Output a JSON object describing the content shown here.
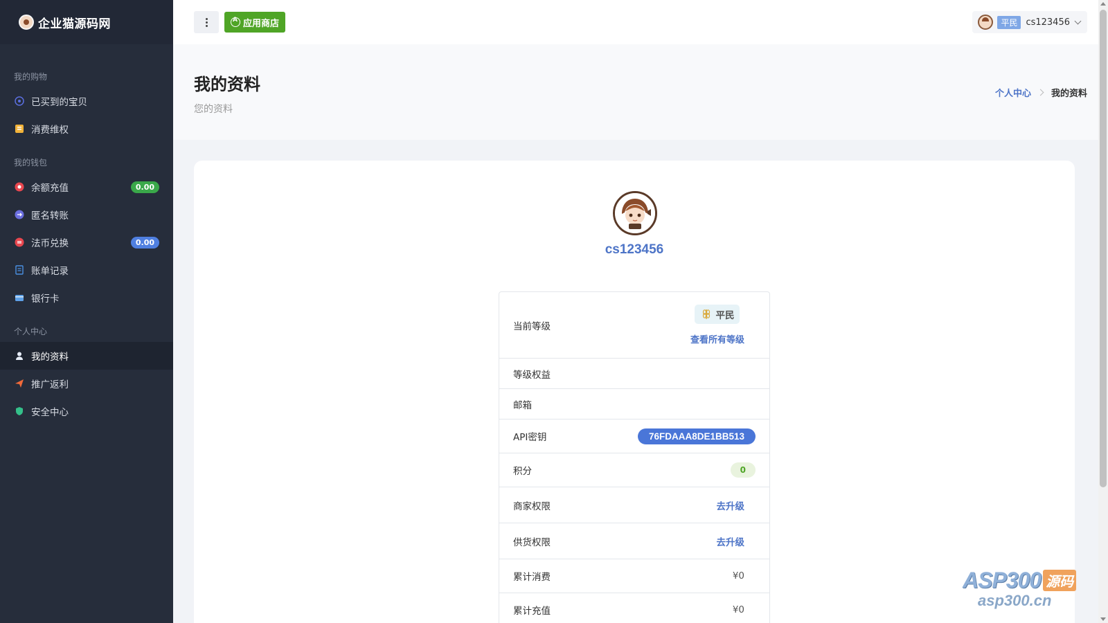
{
  "brand": {
    "name": "企业猫源码网"
  },
  "sidebar": {
    "sections": [
      {
        "title": "我的购物",
        "items": [
          {
            "label": "已买到的宝贝",
            "icon": "bag-circle-icon"
          },
          {
            "label": "消费维权",
            "icon": "complaint-icon"
          }
        ]
      },
      {
        "title": "我的钱包",
        "items": [
          {
            "label": "余额充值",
            "icon": "recharge-icon",
            "badge": "0.00"
          },
          {
            "label": "匿名转账",
            "icon": "transfer-icon"
          },
          {
            "label": "法币兑换",
            "icon": "exchange-icon",
            "badge": "0.00"
          },
          {
            "label": "账单记录",
            "icon": "bill-icon"
          },
          {
            "label": "银行卡",
            "icon": "bank-card-icon"
          }
        ]
      },
      {
        "title": "个人中心",
        "items": [
          {
            "label": "我的资料",
            "icon": "user-icon",
            "active": true
          },
          {
            "label": "推广返利",
            "icon": "paper-plane-icon"
          },
          {
            "label": "安全中心",
            "icon": "shield-icon"
          }
        ]
      }
    ]
  },
  "topbar": {
    "store_label": "应用商店",
    "user_level": "平民",
    "username": "cs123456"
  },
  "page": {
    "title": "我的资料",
    "subtitle": "您的资料",
    "breadcrumb": {
      "parent": "个人中心",
      "current": "我的资料"
    }
  },
  "profile": {
    "username": "cs123456",
    "rows": {
      "level_label": "当前等级",
      "level_value": "平民",
      "level_link": "查看所有等级",
      "benefits_label": "等级权益",
      "email_label": "邮箱",
      "api_label": "API密钥",
      "api_value": "76FDAAA8DE1BB513",
      "points_label": "积分",
      "points_value": "0",
      "merchant_label": "商家权限",
      "merchant_link": "去升级",
      "supply_label": "供货权限",
      "supply_link": "去升级",
      "total_spent_label": "累计消费",
      "total_spent_value": "¥0",
      "total_recharge_label": "累计充值",
      "total_recharge_value": "¥0"
    }
  },
  "watermark": {
    "brand": "ASP300",
    "tag": "源码",
    "domain": "asp300.cn"
  },
  "colors": {
    "sidebar_bg": "#262d3b",
    "accent_blue": "#4d74c7",
    "store_green": "#4fa526",
    "api_blue": "#4a76d8"
  }
}
